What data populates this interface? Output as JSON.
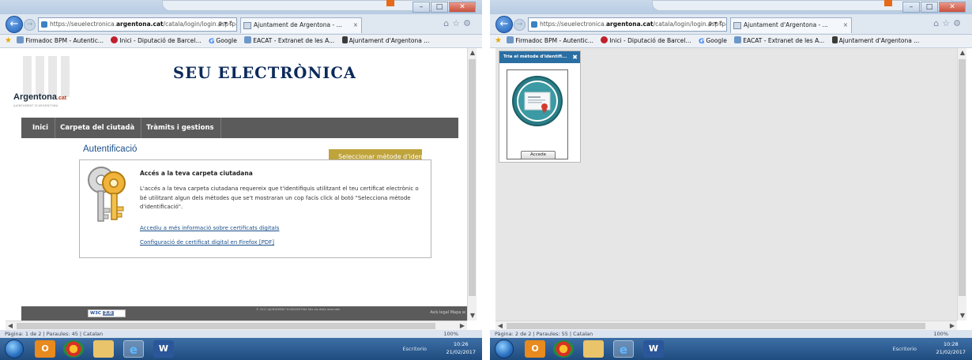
{
  "left": {
    "browser": {
      "address_prefix": "https://seuelectronica.",
      "address_domain": "argentona.cat",
      "address_suffix": "/catala/login/login.asp?pagii",
      "address_tools": "ρ ▾ ċ",
      "tab_label": "Ajuntament de Argentona - ...",
      "tab_close": "×",
      "favorites": [
        "Firmadoc BPM - Autentic...",
        "Inici - Diputació de Barcel...",
        "Google",
        "EACAT - Extranet de les A...",
        "Ajuntament d'Argentona ..."
      ]
    },
    "page": {
      "logo": "Argentona",
      "logo_suffix": ".cat",
      "logo_sub": "AJUNTAMENT D'ARGENTONA",
      "site_title": "SEU ELECTRÒNICA",
      "nav": [
        "Inici",
        "Carpeta del ciutadà",
        "Tràmits i gestions"
      ],
      "section_heading": "Autentificació",
      "select_method_button": "Seleccionar mètode d'identifica",
      "info_title": "Accés a la teva carpeta ciutadana",
      "info_body": "L'accés a la teva carpeta ciutadana requereix que t'identifiquis utilitzant el teu certificat electrònic o bé utilitzant algun dels mètodes que se't mostraran un cop facis click al botó \"Selecciona mètode d'identificació\".",
      "link_more_info": "Accediu a més informació sobre certificats digitals",
      "link_firefox": "Configuració de certificat digital en Firefox [PDF]",
      "w3c": "W3C",
      "w3c_badge": "2.0",
      "footer_copy": "© 2017 AJUNTAMENT D'ARGENTONA Tots els drets reservats",
      "footer_links": "Avís legal    Mapa w"
    },
    "statusbar": "Pàgina: 1 de 2  |  Paraules: 45  |  Catalan",
    "zoom": "100%",
    "tray_label": "Escritorio",
    "time": "10:26",
    "date": "21/02/2017"
  },
  "right": {
    "browser": {
      "address_prefix": "https://seuelectronica.",
      "address_domain": "argentona.cat",
      "address_suffix": "/catala/login/login.asp?pagii",
      "address_tools": "ρ ▾ ċ",
      "tab_label": "Ajuntament d'Argentona - ...",
      "tab_close": "×",
      "favorites": [
        "Firmadoc BPM - Autentic...",
        "Inici - Diputació de Barcel...",
        "Google",
        "EACAT - Extranet de les A...",
        "Ajuntament d'Argentona ..."
      ]
    },
    "dialog": {
      "title": "Tria el mètode d'identifi...",
      "close": "✖",
      "accede_button": "Accede"
    },
    "statusbar": "Pàgina: 2 de 2  |  Paraules: 55  |  Catalan",
    "zoom": "100%",
    "tray_label": "Escritorio",
    "time": "10:28",
    "date": "21/02/2017"
  },
  "taskbar_icons": [
    "outlook-icon",
    "chrome-icon",
    "file-explorer-icon",
    "internet-explorer-icon",
    "word-icon"
  ],
  "colors": {
    "nav_bar": "#5b5b5b",
    "heading_blue": "#1b4f8a",
    "gold_button": "#bfa33b",
    "dialog_blue": "#2a6fa4",
    "title_navy": "#0c2a5a"
  }
}
